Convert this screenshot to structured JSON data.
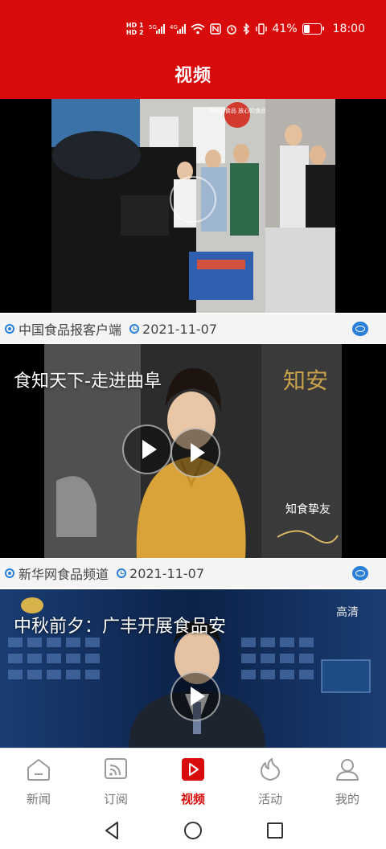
{
  "status_bar": {
    "hd1": "HD 1",
    "hd2": "HD 2",
    "net1": "5G",
    "net2": "4G",
    "battery": "41%",
    "battery_level": 0.41,
    "time": "18:00"
  },
  "header": {
    "title": "视频"
  },
  "videos": [
    {
      "title": "",
      "source": "中国食品报客户端",
      "date": "2021-11-07"
    },
    {
      "title": "食知天下-走进曲阜",
      "source": "新华网食品频道",
      "date": "2021-11-07"
    },
    {
      "title": "中秋前夕：广丰开展食品安",
      "source": "",
      "date": ""
    }
  ],
  "thumb_text": {
    "card1_sign": "合格的食品 放心的食品",
    "card2_brand": "知食挚友",
    "card2_logo": "知安",
    "card3_tag": "高清"
  },
  "tabbar": {
    "items": [
      {
        "label": "新闻",
        "icon": "home-icon"
      },
      {
        "label": "订阅",
        "icon": "rss-icon"
      },
      {
        "label": "视频",
        "icon": "video-play-icon"
      },
      {
        "label": "活动",
        "icon": "flame-icon"
      },
      {
        "label": "我的",
        "icon": "user-icon"
      }
    ],
    "active_index": 2
  },
  "navbar": {
    "back": "back-icon",
    "home": "home-circle-icon",
    "recent": "recent-apps-icon"
  },
  "colors": {
    "brand_red": "#d90a0a",
    "accent_blue": "#2a7fd6",
    "inactive_gray": "#777777"
  }
}
